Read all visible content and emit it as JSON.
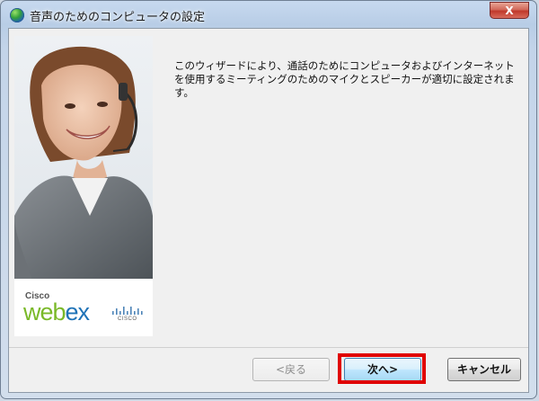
{
  "window": {
    "title": "音声のためのコンピュータの設定",
    "close_label": "X"
  },
  "side_panel": {
    "brand_small": "Cisco",
    "brand_main_prefix": "web",
    "brand_main_suffix": "ex",
    "company": "CISCO",
    "colors": {
      "webex_green": "#7ab929",
      "webex_blue": "#1f73b7"
    }
  },
  "content": {
    "description": "このウィザードにより、通話のためにコンピュータおよびインターネットを使用するミーティングのためのマイクとスピーカーが適切に設定されます。"
  },
  "buttons": {
    "back": "<戻る",
    "next": "次へ>",
    "cancel": "キャンセル"
  },
  "annotation": {
    "highlight_color": "#e00000"
  }
}
